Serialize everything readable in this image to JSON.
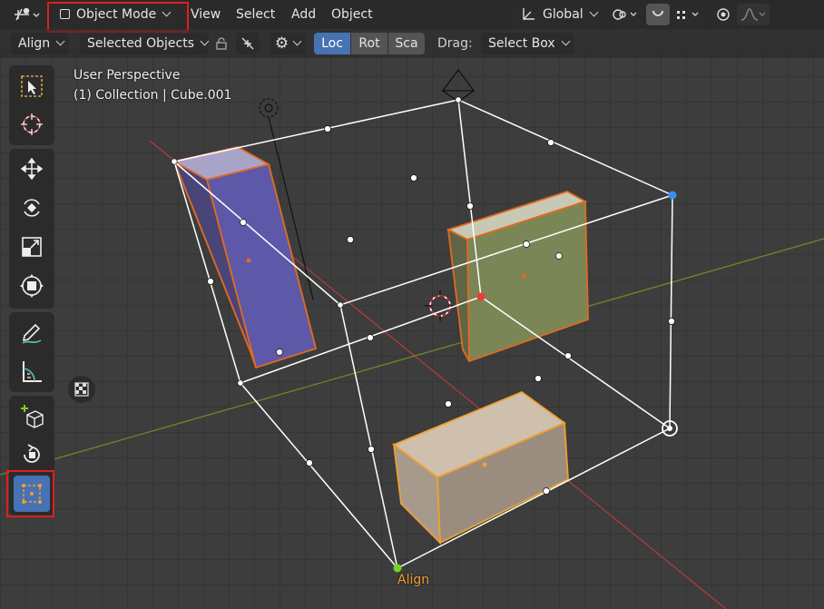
{
  "header": {
    "mode_label": "Object Mode",
    "menus": [
      "View",
      "Select",
      "Add",
      "Object"
    ],
    "orientation_label": "Global"
  },
  "tool_settings": {
    "align_label": "Align",
    "relative_to_label": "Selected Objects",
    "transform_tabs": [
      "Loc",
      "Rot",
      "Sca"
    ],
    "active_tab": "Loc",
    "drag_label": "Drag:",
    "drag_value": "Select Box"
  },
  "viewport": {
    "perspective": "User Perspective",
    "collection": "(1) Collection | Cube.001",
    "gizmo_label": "Align"
  },
  "toolbar": {
    "tools": [
      "select-box-icon",
      "cursor-icon",
      "move-icon",
      "rotate-icon",
      "scale-icon",
      "transform-icon",
      "annotate-icon",
      "measure-icon",
      "add-cube-icon",
      "spin-icon",
      "align-tool-icon"
    ],
    "active_tool": "align-tool-icon"
  },
  "colors": {
    "accent": "#4772b3",
    "highlight": "#e01e1e",
    "active_outline": "#f0a030",
    "selected_outline": "#e06a20"
  }
}
